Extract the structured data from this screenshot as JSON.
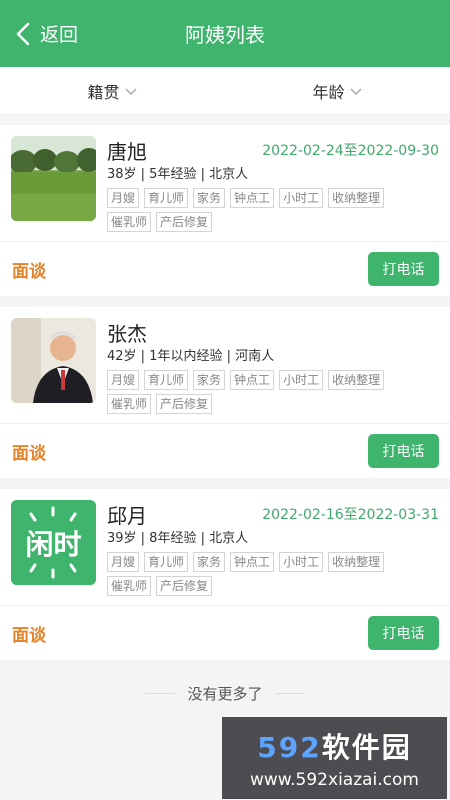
{
  "header": {
    "back_label": "返回",
    "title": "阿姨列表"
  },
  "filters": [
    {
      "label": "籍贯"
    },
    {
      "label": "年龄"
    }
  ],
  "nannies": [
    {
      "name": "唐旭",
      "dates": "2022-02-24至2022-09-30",
      "meta": "38岁 | 5年经验 | 北京人",
      "tags": [
        "月嫂",
        "育儿师",
        "家务",
        "钟点工",
        "小时工",
        "收纳整理",
        "催乳师",
        "产后修复"
      ],
      "action_left": "面谈",
      "action_right": "打电话"
    },
    {
      "name": "张杰",
      "dates": "",
      "meta": "42岁 | 1年以内经验 | 河南人",
      "tags": [
        "月嫂",
        "育儿师",
        "家务",
        "钟点工",
        "小时工",
        "收纳整理",
        "催乳师",
        "产后修复"
      ],
      "action_left": "面谈",
      "action_right": "打电话"
    },
    {
      "name": "邱月",
      "dates": "2022-02-16至2022-03-31",
      "meta": "39岁 | 8年经验 | 北京人",
      "tags": [
        "月嫂",
        "育儿师",
        "家务",
        "钟点工",
        "小时工",
        "收纳整理",
        "催乳师",
        "产后修复"
      ],
      "action_left": "面谈",
      "action_right": "打电话"
    }
  ],
  "logo_text": "闲时",
  "footer_text": "没有更多了",
  "watermark": {
    "title_num": "592",
    "title_text": "软件园",
    "url": "www.592xiazai.com"
  },
  "colors": {
    "primary": "#3fb46d",
    "accent": "#e5832a",
    "date": "#3fa86a"
  }
}
